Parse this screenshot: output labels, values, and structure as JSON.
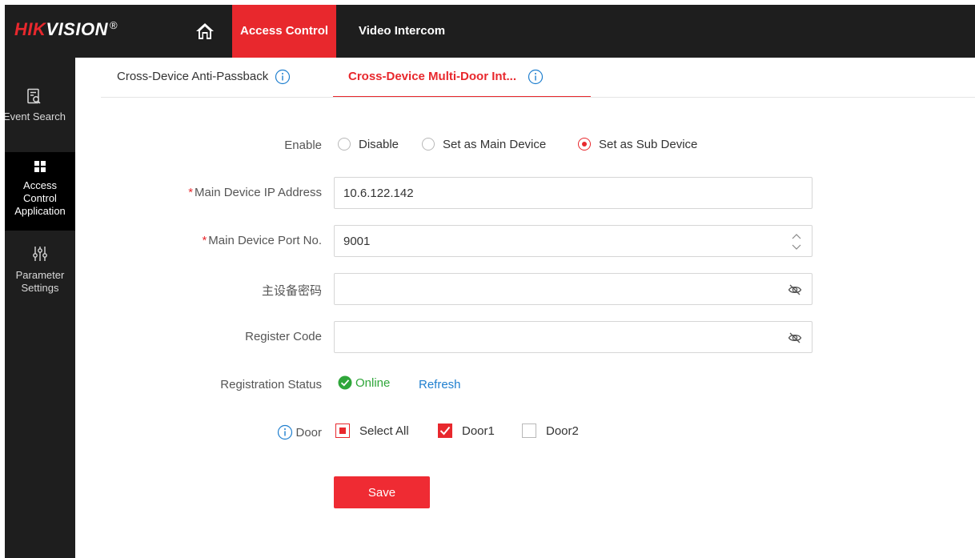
{
  "header": {
    "logo_brand_part1": "HIK",
    "logo_brand_part2": "VISION",
    "logo_registered": "®",
    "nav": [
      {
        "label": "Access Control",
        "active": true
      },
      {
        "label": "Video Intercom",
        "active": false
      }
    ]
  },
  "sidebar": {
    "items": [
      {
        "label": "Event Search",
        "icon": "event-search-icon"
      },
      {
        "label_line1": "Access",
        "label_line2": "Control",
        "label_line3": "Application",
        "icon": "grid-icon",
        "active": true
      },
      {
        "label_line1": "Parameter",
        "label_line2": "Settings",
        "icon": "sliders-icon"
      }
    ]
  },
  "tabs": [
    {
      "label": "Cross-Device Anti-Passback",
      "active": false
    },
    {
      "label": "Cross-Device Multi-Door Int...",
      "active": true
    }
  ],
  "form": {
    "enable": {
      "label": "Enable",
      "options": [
        "Disable",
        "Set as Main Device",
        "Set as Sub Device"
      ],
      "selected": "Set as Sub Device"
    },
    "main_ip": {
      "required_mark": "*",
      "label": "Main Device IP Address",
      "value": "10.6.122.142"
    },
    "main_port": {
      "required_mark": "*",
      "label": "Main Device Port No.",
      "value": "9001"
    },
    "main_password": {
      "label": "主设备密码",
      "value": ""
    },
    "register_code": {
      "label": "Register Code",
      "value": ""
    },
    "registration_status": {
      "label": "Registration Status",
      "value": "Online",
      "refresh_label": "Refresh"
    },
    "door": {
      "label": "Door",
      "select_all_label": "Select All",
      "select_all_state": "indeterminate",
      "options": [
        {
          "label": "Door1",
          "checked": true
        },
        {
          "label": "Door2",
          "checked": false
        }
      ]
    },
    "save_label": "Save"
  },
  "colors": {
    "accent": "#e8282d",
    "header_bg": "#1e1e1e",
    "status_online": "#2fa63a",
    "link": "#1f7fcf"
  }
}
